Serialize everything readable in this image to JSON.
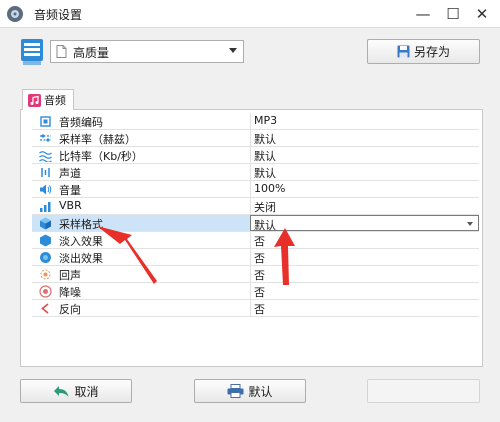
{
  "window": {
    "title": "音频设置"
  },
  "toolbar": {
    "preset_value": "高质量",
    "save_as_label": "另存为"
  },
  "tab": {
    "label": "音频"
  },
  "rows": [
    {
      "name": "音频编码",
      "value": "MP3",
      "icon": "chip-icon"
    },
    {
      "name": "采样率（赫兹）",
      "value": "默认",
      "icon": "sample-rate-icon"
    },
    {
      "name": "比特率（Kb/秒）",
      "value": "默认",
      "icon": "bitrate-icon"
    },
    {
      "name": "声道",
      "value": "默认",
      "icon": "channel-icon"
    },
    {
      "name": "音量",
      "value": "100%",
      "icon": "volume-icon"
    },
    {
      "name": "VBR",
      "value": "关闭",
      "icon": "vbr-icon"
    },
    {
      "name": "采样格式",
      "value": "默认",
      "icon": "cube-icon"
    },
    {
      "name": "淡入效果",
      "value": "否",
      "icon": "fade-in-icon"
    },
    {
      "name": "淡出效果",
      "value": "否",
      "icon": "fade-out-icon"
    },
    {
      "name": "回声",
      "value": "否",
      "icon": "echo-icon"
    },
    {
      "name": "降噪",
      "value": "否",
      "icon": "denoise-icon"
    },
    {
      "name": "反向",
      "value": "否",
      "icon": "reverse-icon"
    }
  ],
  "footer": {
    "cancel_label": "取消",
    "default_label": "默认"
  },
  "colors": {
    "selection": "#cde3f7",
    "annotation_arrow": "#e8302a",
    "accent_blue": "#2e8bd8"
  }
}
